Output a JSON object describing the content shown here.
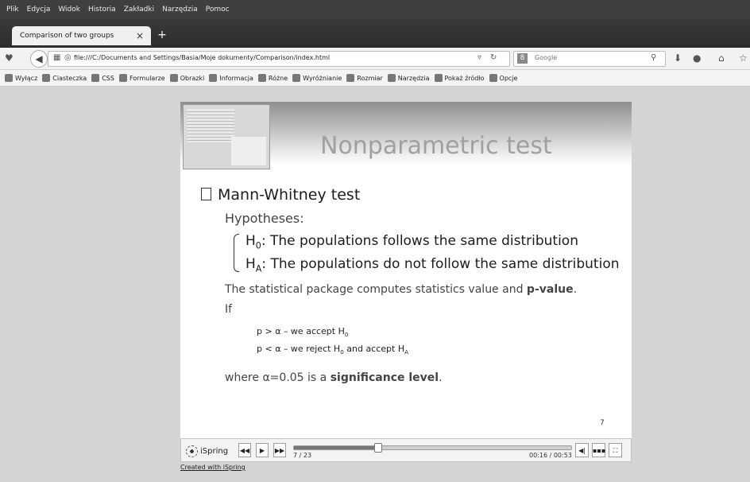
{
  "menu": [
    "Plik",
    "Edycja",
    "Widok",
    "Historia",
    "Zakładki",
    "Narzędzia",
    "Pomoc"
  ],
  "tab": {
    "title": "Comparison of two groups",
    "close": "×",
    "new": "+"
  },
  "nav": {
    "url": "file:///C:/Documents and Settings/Basia/Moje dokumenty/Comparison/index.html",
    "search_placeholder": "Google"
  },
  "bookmarks": [
    "Wyłącz",
    "Ciasteczka",
    "CSS",
    "Formularze",
    "Obrazki",
    "Informacja",
    "Różne",
    "Wyróżnianie",
    "Rozmiar",
    "Narzędzia",
    "Pokaż źródło",
    "Opcje"
  ],
  "slide": {
    "title": "Nonparametric test",
    "heading": "Mann-Whitney test",
    "hypotheses_label": "Hypotheses:",
    "h0_sub": "0",
    "h0_text": ": The populations follows the same distribution",
    "ha_sub": "A",
    "ha_text": ": The populations do not follow the same distribution",
    "stat_line": "The statistical package computes statistics value and ",
    "pvalue": "p-value",
    "period": ".",
    "if": "If",
    "cond1_pre": "p > α – we accept H",
    "cond1_sub": "0",
    "cond2_pre": "p < α – we reject H",
    "cond2_sub": "0",
    "cond2_mid": " and accept H",
    "cond2_sub2": "A",
    "alpha_pre": "where α=0.05 is a ",
    "alpha_bold": "significance level",
    "alpha_end": ".",
    "page": "7"
  },
  "player": {
    "logo": "iSpring",
    "slide_counter": "7 / 23",
    "time": "00:16 / 00:53",
    "progress": 0.3
  },
  "footer": {
    "created": "Created with iSpring"
  }
}
